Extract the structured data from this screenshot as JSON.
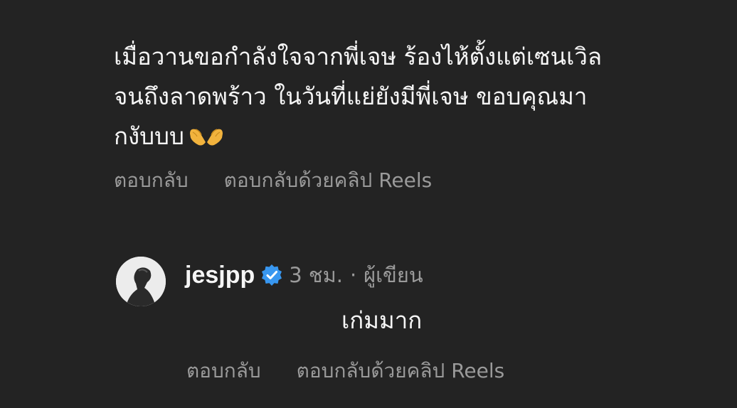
{
  "comment": {
    "lines": [
      "เมื่อวานขอกำลังใจจากพี่เจษ ร้องไห้ตั้งแต่เซนเวิล",
      "จนถึงลาดพร้าว ในวันที่แย่ยังมีพี่เจษ ขอบคุณมา",
      "กงับบบ"
    ],
    "emoji": "heart-hands-emoji"
  },
  "comment_actions": {
    "reply": "ตอบกลับ",
    "reply_reels": "ตอบกลับด้วยคลิป Reels"
  },
  "reply": {
    "username": "jesjpp",
    "verified": true,
    "time": "3 ชม.",
    "separator": "·",
    "role": "ผู้เขียน",
    "text": "เก่มมาก",
    "avatar": "profile-photo"
  },
  "reply_actions": {
    "reply": "ตอบกลับ",
    "reply_reels": "ตอบกลับด้วยคลิป Reels"
  },
  "colors": {
    "background": "#232323",
    "text": "#f5f5f5",
    "muted": "#9a9a9a",
    "verified": "#3897f0"
  }
}
